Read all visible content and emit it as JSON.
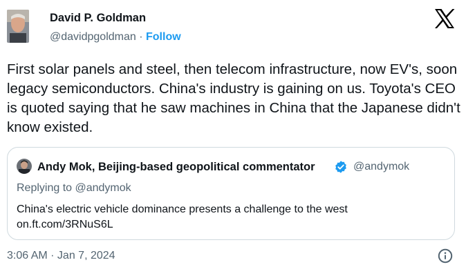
{
  "author": {
    "name": "David P. Goldman",
    "handle": "@davidpgoldman",
    "separator": "·",
    "follow_label": "Follow"
  },
  "platform_icon": "x-logo-icon",
  "tweet": {
    "text": "First solar panels and steel, then telecom infrastructure, now EV's, soon legacy semiconductors. China's industry is gaining on us. Toyota's CEO is quoted saying that he saw machines in China that the Japanese didn't know existed."
  },
  "quoted": {
    "name": "Andy Mok, Beijing-based geopolitical commentator",
    "verified_icon": "verified-badge-icon",
    "handle": "@andymok",
    "replying_to": "Replying to @andymok",
    "line1": "China's electric vehicle dominance presents a challenge to the west",
    "line2": "on.ft.com/3RNuS6L"
  },
  "footer": {
    "timestamp": "3:06 AM · Jan 7, 2024",
    "info_icon": "info-icon"
  },
  "colors": {
    "text": "#0f1419",
    "secondary": "#536471",
    "accent": "#1d9bf0",
    "border": "#cfd9de"
  }
}
